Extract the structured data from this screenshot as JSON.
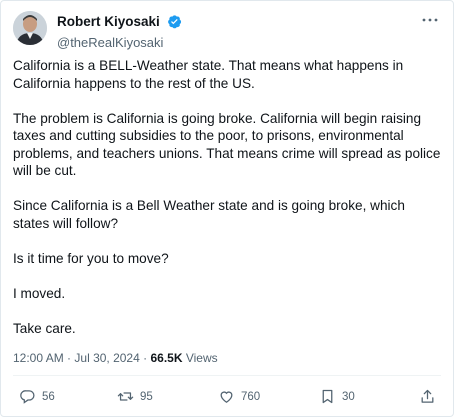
{
  "author": {
    "display_name": "Robert Kiyosaki",
    "handle": "@theRealKiyosaki",
    "verified": true
  },
  "tweet": {
    "paragraphs": [
      "California is a BELL-Weather state. That means what happens in California happens to the rest of the US.",
      "The problem is California is going broke. California will begin raising taxes and cutting subsidies to the poor, to prisons, environmental problems, and teachers unions. That means crime will spread as police will be cut.",
      "Since California is a Bell Weather state and is going broke, which states will follow?",
      "Is it time for you to move?",
      "I moved.",
      "Take care."
    ],
    "time": "12:00 AM",
    "separator": "·",
    "date": "Jul 30, 2024",
    "views_count": "66.5K",
    "views_label": "Views"
  },
  "actions": {
    "replies": "56",
    "reposts": "95",
    "likes": "760",
    "bookmarks": "30"
  },
  "colors": {
    "verified_blue": "#1d9bf0",
    "text_primary": "#0f1419",
    "text_secondary": "#536471"
  },
  "icons": [
    "verified-badge-icon",
    "more-icon",
    "reply-icon",
    "repost-icon",
    "like-icon",
    "bookmark-icon",
    "share-icon"
  ]
}
